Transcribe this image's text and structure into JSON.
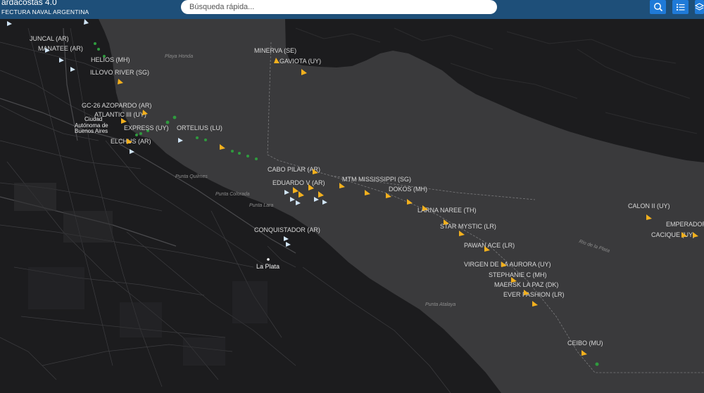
{
  "header": {
    "title": "ardacostas 4.0",
    "subtitle": "FECTURA NAVAL ARGENTINA",
    "search_placeholder": "Búsqueda rápida...",
    "buttons": [
      {
        "name": "search-button",
        "icon": "search-icon"
      },
      {
        "name": "list-button",
        "icon": "list-icon"
      },
      {
        "name": "layers-button",
        "icon": "layers-icon"
      }
    ]
  },
  "colors": {
    "header_bg": "#1e4f79",
    "button_bg": "#1f7ad8",
    "water": "#3a3a3c",
    "land": "#1c1c1e",
    "vessel_cargo": "#f2b01e",
    "vessel_other": "#cfe3f5",
    "track": "#2f9a3e"
  },
  "vessels": [
    {
      "label": "JUNCAL (AR)"
    },
    {
      "label": "MANATEE (AR)"
    },
    {
      "label": "HELIOS (MH)"
    },
    {
      "label": "ILLOVO RIVER (SG)"
    },
    {
      "label": "MINERVA (SE)"
    },
    {
      "label": "GAVIOTA (UY)"
    },
    {
      "label": "GC-26 AZOPARDO (AR)"
    },
    {
      "label": "ATLANTIC III (UY)"
    },
    {
      "label": "EXPRESS (UY)"
    },
    {
      "label": "ORTELIUS (LU)"
    },
    {
      "label": "ELCHUS (AR)"
    },
    {
      "label": "CABO PILAR (AR)"
    },
    {
      "label": "EDUARDO V (AR)"
    },
    {
      "label": "MTM MISSISSIPPI (SG)"
    },
    {
      "label": "DOKOS (MH)"
    },
    {
      "label": "LARNA NAREE (TH)"
    },
    {
      "label": "STAR MYSTIC (LR)"
    },
    {
      "label": "PAWAN ACE (LR)"
    },
    {
      "label": "VIRGEN DE LA AURORA (UY)"
    },
    {
      "label": "STEPHANIE C (MH)"
    },
    {
      "label": "MAERSK LA PAZ (DK)"
    },
    {
      "label": "EVER FASHION (LR)"
    },
    {
      "label": "CONQUISTADOR (AR)"
    },
    {
      "label": "CALON II (UY)"
    },
    {
      "label": "EMPERADOR"
    },
    {
      "label": "CACIQUE (UY)"
    },
    {
      "label": "CEIBO (MU)"
    }
  ],
  "places": [
    {
      "label": "Playa Honda"
    },
    {
      "label": "Punta Quilmes"
    },
    {
      "label": "Punta Colorada"
    },
    {
      "label": "Punta Lara"
    },
    {
      "label": "Punta Atalaya"
    },
    {
      "label": "Rio de la Plata"
    }
  ],
  "cities": [
    {
      "label": "Ciudad"
    },
    {
      "label": "Autónoma de"
    },
    {
      "label": "Buenos Aires"
    },
    {
      "label": "La Plata"
    }
  ]
}
